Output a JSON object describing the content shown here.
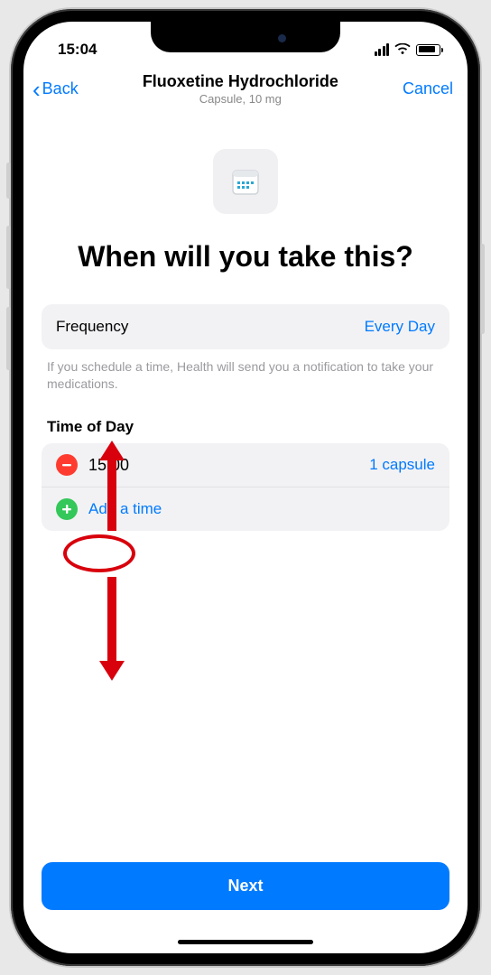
{
  "status": {
    "time": "15:04"
  },
  "nav": {
    "back": "Back",
    "title": "Fluoxetine Hydrochloride",
    "subtitle": "Capsule, 10 mg",
    "cancel": "Cancel"
  },
  "heading": "When will you take this?",
  "frequency": {
    "label": "Frequency",
    "value": "Every Day"
  },
  "hint": "If you schedule a time, Health will send you a notification to take your medications.",
  "time_section_label": "Time of Day",
  "times": [
    {
      "time": "15:00",
      "dosage": "1 capsule"
    }
  ],
  "add_time_label": "Add a time",
  "next_label": "Next",
  "colors": {
    "accent": "#007aff",
    "danger": "#ff3b30",
    "success": "#34c759",
    "annotation": "#d8000c"
  }
}
